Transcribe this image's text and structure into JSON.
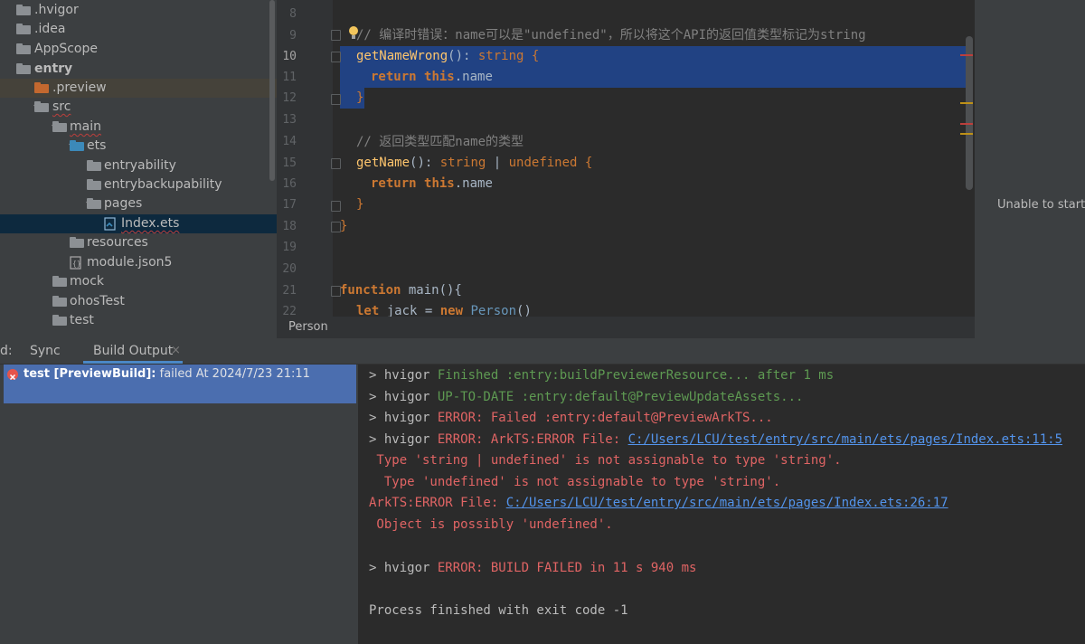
{
  "tree": {
    "items": [
      {
        "label": ".hvigor"
      },
      {
        "label": ".idea"
      },
      {
        "label": "AppScope"
      },
      {
        "label": "entry"
      },
      {
        "label": ".preview"
      },
      {
        "label": "src"
      },
      {
        "label": "main"
      },
      {
        "label": "ets"
      },
      {
        "label": "entryability"
      },
      {
        "label": "entrybackupability"
      },
      {
        "label": "pages"
      },
      {
        "label": "Index.ets"
      },
      {
        "label": "resources"
      },
      {
        "label": "module.json5"
      },
      {
        "label": "mock"
      },
      {
        "label": "ohosTest"
      },
      {
        "label": "test"
      }
    ]
  },
  "editor": {
    "line_numbers": [
      "8",
      "9",
      "10",
      "11",
      "12",
      "13",
      "14",
      "15",
      "16",
      "17",
      "18",
      "19",
      "20",
      "21",
      "22"
    ],
    "code": {
      "l9_comment": "// 编译时错误：name可以是\"undefined\"，所以将这个API的返回值类型标记为string",
      "l10_fn": "getNameWrong",
      "l10_rest": "(): ",
      "l10_type": "string",
      "l10_brace": " {",
      "l11_kw": "return ",
      "l11_this": "this",
      "l11_rest": ".name",
      "l12": "}",
      "l14_comment": "// 返回类型匹配name的类型",
      "l15_fn": "getName",
      "l15_rest": "(): ",
      "l15_type1": "string",
      "l15_pipe": " | ",
      "l15_type2": "undefined",
      "l15_brace": " {",
      "l16_kw": "return ",
      "l16_this": "this",
      "l16_rest": ".name",
      "l17": "}",
      "l18": "}",
      "l21_kw": "function ",
      "l21_fn": "main",
      "l21_rest": "(){",
      "l22_kw": "let ",
      "l22_rest": "jack = ",
      "l22_new": "new ",
      "l22_cls": "Person",
      "l22_end": "()"
    },
    "breadcrumb": "Person"
  },
  "preview_panel": {
    "message": "Unable to start"
  },
  "bottom_tabs": {
    "partial": "d:",
    "sync": "Sync",
    "build_output": "Build Output",
    "close": "×"
  },
  "build_tree": {
    "name": "test [PreviewBuild]:",
    "status": " failed At 2024/7/23 21:11"
  },
  "console": {
    "l1_prefix": "> hvigor ",
    "l1_text": "Finished :entry:buildPreviewerResource... after 1 ms",
    "l2_prefix": "> hvigor ",
    "l2_text": "UP-TO-DATE :entry:default@PreviewUpdateAssets...",
    "l3_prefix": "> hvigor ",
    "l3_text": "ERROR: Failed :entry:default@PreviewArkTS...",
    "l4_prefix": "> hvigor ",
    "l4_text": "ERROR: ArkTS:ERROR File: ",
    "l4_link": "C:/Users/LCU/test/entry/src/main/ets/pages/Index.ets:11:5",
    "l5": " Type 'string | undefined' is not assignable to type 'string'.",
    "l6": "  Type 'undefined' is not assignable to type 'string'.",
    "l7_text": "ArkTS:ERROR File: ",
    "l7_link": "C:/Users/LCU/test/entry/src/main/ets/pages/Index.ets:26:17",
    "l8": " Object is possibly 'undefined'.",
    "l9_prefix": "> hvigor ",
    "l9_text": "ERROR: BUILD FAILED in 11 s 940 ms",
    "l10": "Process finished with exit code -1"
  },
  "colors": {
    "accent_selection": "#214283",
    "error": "#e06464",
    "success": "#5e9a52",
    "link": "#5394ec"
  }
}
